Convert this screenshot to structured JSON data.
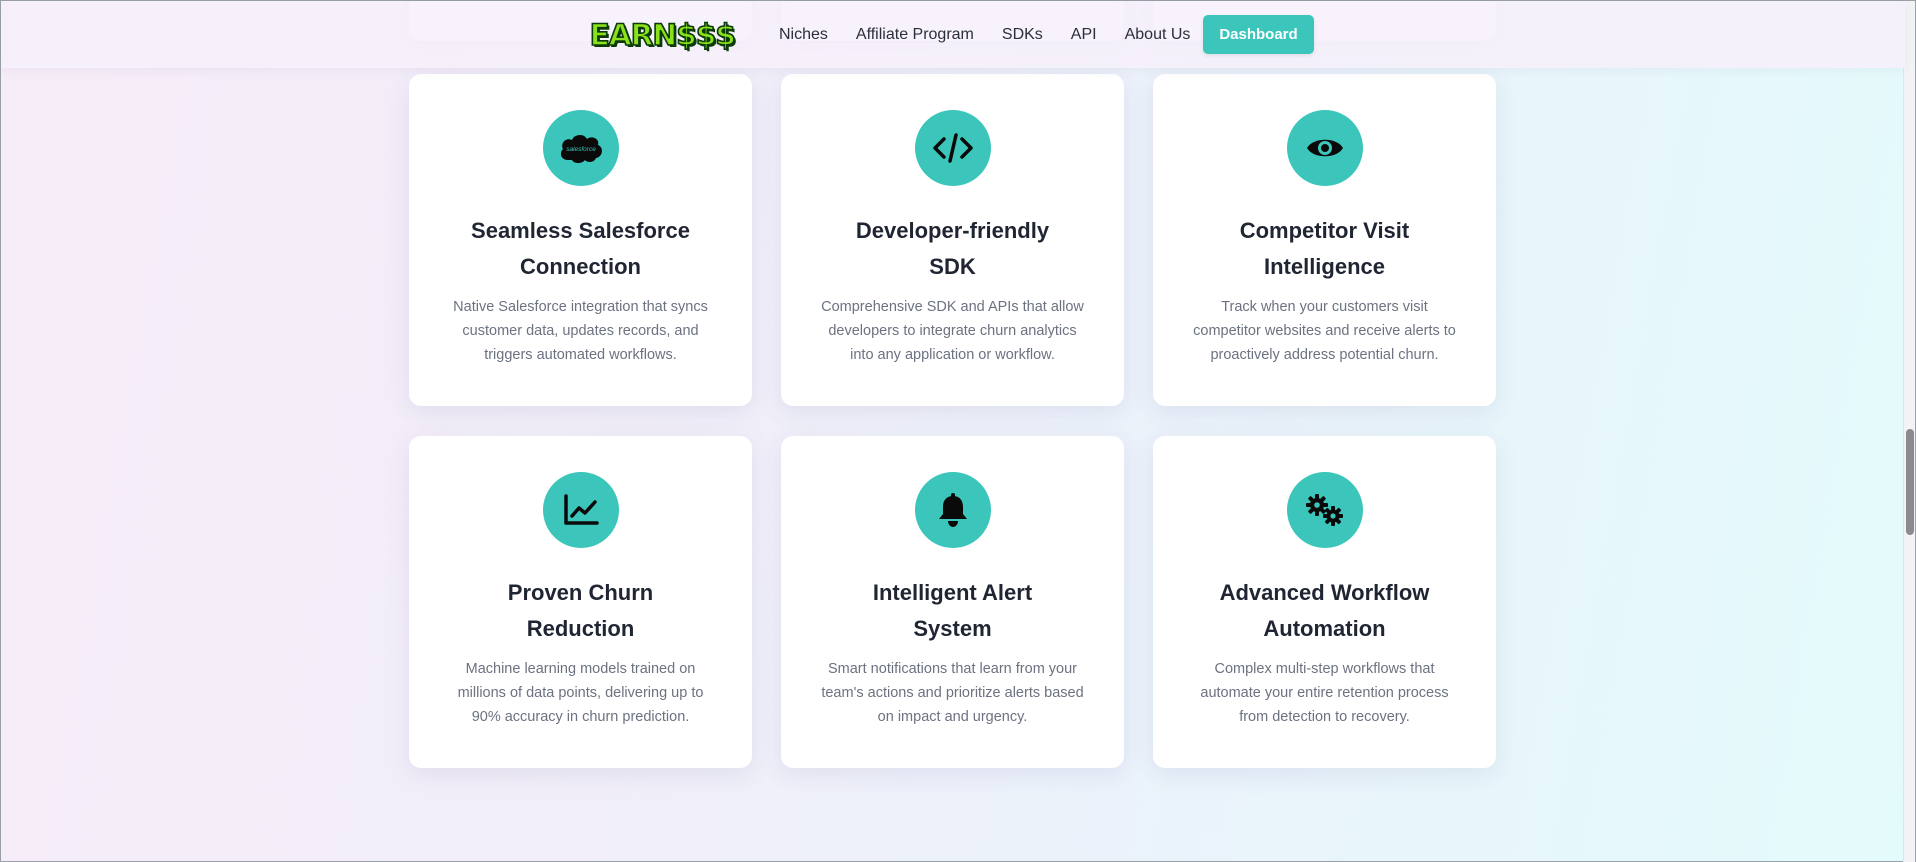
{
  "brand": {
    "logo_text": "EARN$$$"
  },
  "nav": {
    "items": [
      "Niches",
      "Affiliate Program",
      "SDKs",
      "API",
      "About Us"
    ],
    "cta_label": "Dashboard"
  },
  "colors": {
    "accent": "#3cc6bb",
    "heading": "#1f2532",
    "body_text": "#6b7280"
  },
  "features": [
    {
      "icon": "salesforce-cloud-icon",
      "icon_text": "salesforce",
      "title": "Seamless Salesforce Connection",
      "description": "Native Salesforce integration that syncs customer data, updates records, and triggers automated workflows."
    },
    {
      "icon": "code-icon",
      "title": "Developer-friendly SDK",
      "description": "Comprehensive SDK and APIs that allow developers to integrate churn analytics into any application or workflow."
    },
    {
      "icon": "eye-icon",
      "title": "Competitor Visit Intelligence",
      "description": "Track when your customers visit competitor websites and receive alerts to proactively address potential churn."
    },
    {
      "icon": "chart-line-icon",
      "title": "Proven Churn Reduction",
      "description": "Machine learning models trained on millions of data points, delivering up to 90% accuracy in churn prediction."
    },
    {
      "icon": "bell-icon",
      "title": "Intelligent Alert System",
      "description": "Smart notifications that learn from your team's actions and prioritize alerts based on impact and urgency."
    },
    {
      "icon": "gears-icon",
      "title": "Advanced Workflow Automation",
      "description": "Complex multi-step workflows that automate your entire retention process from detection to recovery."
    }
  ]
}
